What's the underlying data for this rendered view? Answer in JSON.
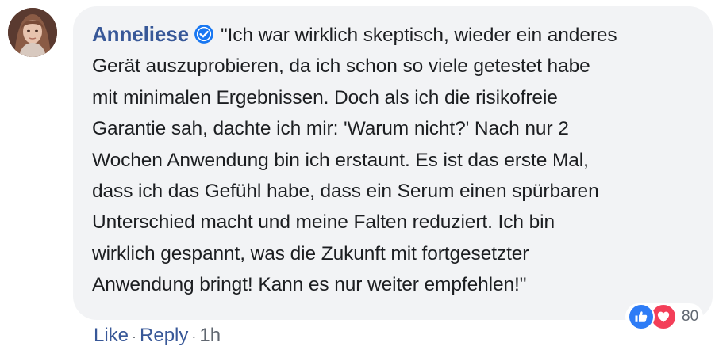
{
  "comment": {
    "author": "Anneliese",
    "verified_icon": "verified-badge-icon",
    "lines": [
      "\"Ich war wirklich skeptisch, wieder ein anderes",
      "Gerät auszuprobieren, da ich schon so viele getestet habe",
      "mit minimalen Ergebnissen. Doch als ich die risikofreie",
      "Garantie sah, dachte ich mir: 'Warum nicht?' Nach nur 2",
      "Wochen Anwendung bin ich erstaunt. Es ist das erste Mal,",
      "dass ich das Gefühl habe, dass ein Serum einen spürbaren",
      "Unterschied macht und meine Falten reduziert. Ich bin",
      "wirklich gespannt, was die Zukunft mit fortgesetzter",
      "Anwendung bringt! Kann es nur weiter empfehlen!\""
    ]
  },
  "reactions": {
    "icons": [
      "like-icon",
      "love-icon"
    ],
    "count": "80",
    "like_color": "#2e7cf6",
    "love_color": "#f33e58"
  },
  "actions": {
    "like_label": "Like",
    "reply_label": "Reply",
    "separator": "·",
    "timestamp": "1h"
  },
  "colors": {
    "link": "#385898",
    "bubble": "#f2f3f5",
    "text": "#1c1e21",
    "meta": "#606770"
  }
}
